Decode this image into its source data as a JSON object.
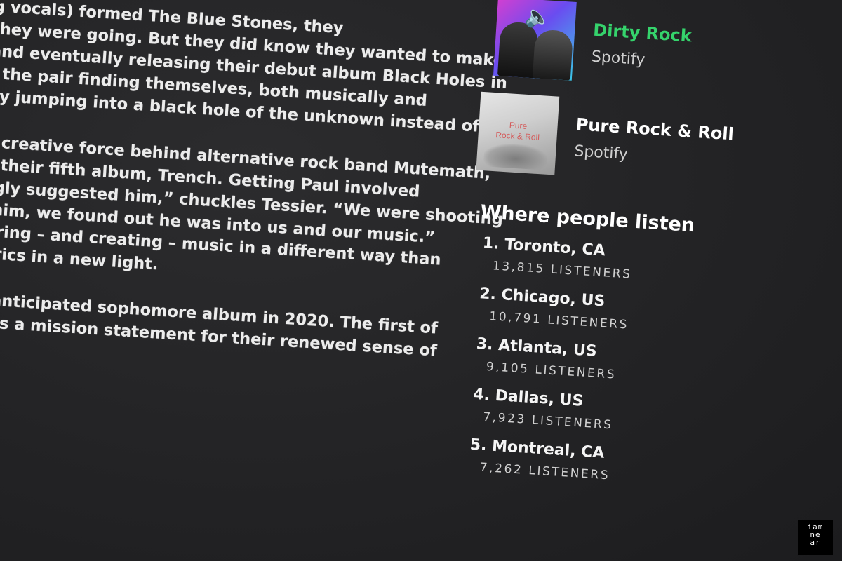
{
  "bio": {
    "paragraphs": [
      [
        "g vocals) formed The Blue Stones, they",
        "they were going. But they did know they wanted to make",
        "and eventually releasing their debut album Black Holes in",
        "t the pair finding themselves, both musically and",
        "by jumping into a black hole of the unknown instead of"
      ],
      [
        "e creative force behind alternative rock band Mutemath,",
        "g their fifth album, Trench. Getting Paul involved",
        "ngly suggested him,” chuckles Tessier. “We were shooting",
        "l him, we found out he was into us and our music.”",
        "loring – and creating – music in a different way than",
        "lyrics in a new light."
      ],
      [
        "y anticipated sophomore album in 2020. The first of",
        "s as a mission statement for their renewed sense of"
      ]
    ]
  },
  "playlists": [
    {
      "title": "Dirty Rock",
      "owner": "Spotify",
      "title_color": "#35d36c",
      "icon": "speaker-icon"
    },
    {
      "title": "Pure Rock & Roll",
      "owner": "Spotify",
      "cover_text_line1": "Pure",
      "cover_text_line2": "Rock & Roll"
    }
  ],
  "where_people_listen": {
    "title": "Where people listen",
    "cities": [
      {
        "name": "1. Toronto, CA",
        "listeners": "13,815 LISTENERS"
      },
      {
        "name": "2. Chicago, US",
        "listeners": "10,791 LISTENERS"
      },
      {
        "name": "3. Atlanta, US",
        "listeners": "9,105 LISTENERS"
      },
      {
        "name": "4. Dallas, US",
        "listeners": "7,923 LISTENERS"
      },
      {
        "name": "5. Montreal, CA",
        "listeners": "7,262 LISTENERS"
      }
    ]
  },
  "watermark": {
    "line1": "iam",
    "line2": "ne",
    "line3": "ar"
  }
}
